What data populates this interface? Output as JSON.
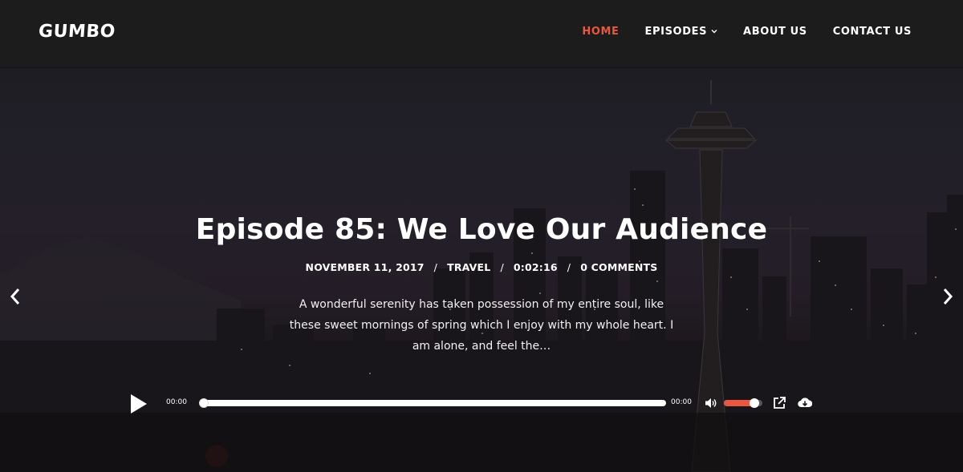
{
  "header": {
    "logo": "GUMBO",
    "nav": [
      {
        "label": "HOME",
        "active": true
      },
      {
        "label": "EPISODES",
        "active": false,
        "has_dropdown": true
      },
      {
        "label": "ABOUT US",
        "active": false
      },
      {
        "label": "CONTACT US",
        "active": false
      }
    ]
  },
  "hero": {
    "title": "Episode 85: We Love Our Audience",
    "meta": {
      "date": "NOVEMBER 11, 2017",
      "category": "TRAVEL",
      "duration": "0:02:16",
      "comments": "0 COMMENTS",
      "separator": "/"
    },
    "excerpt": "A wonderful serenity has taken possession of my entire soul, like these sweet mornings of spring which I enjoy with my whole heart. I am alone, and feel the…",
    "prev_icon": "chevron-left-icon",
    "next_icon": "chevron-right-icon"
  },
  "player": {
    "current_time": "00:00",
    "duration_time": "00:00",
    "progress": 0,
    "volume": 0.8,
    "icons": [
      "play-icon",
      "volume-icon",
      "share-icon",
      "download-icon"
    ]
  },
  "colors": {
    "accent": "#e8573f",
    "header_bg": "#1c1c1c",
    "text": "#ffffff"
  }
}
